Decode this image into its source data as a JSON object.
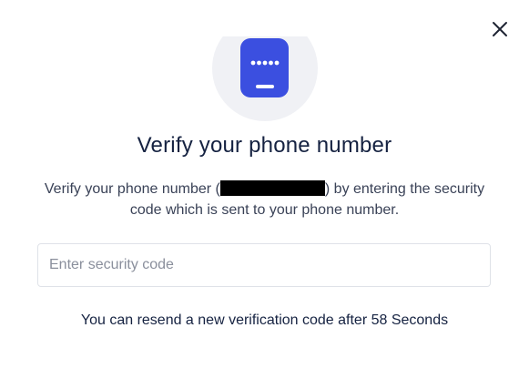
{
  "modal": {
    "title": "Verify your phone number",
    "description_before": "Verify your phone number (",
    "description_after": ") by entering the security code which is sent to your phone number.",
    "input_placeholder": "Enter security code",
    "resend_text": "You can resend a new verification code after 58 Seconds",
    "close_icon": "close-icon",
    "hero_icon": "phone-passcode-icon"
  },
  "colors": {
    "accent": "#3b4fe0",
    "title": "#152241",
    "text": "#3a4257",
    "hero_circle": "#f0f1f5"
  }
}
